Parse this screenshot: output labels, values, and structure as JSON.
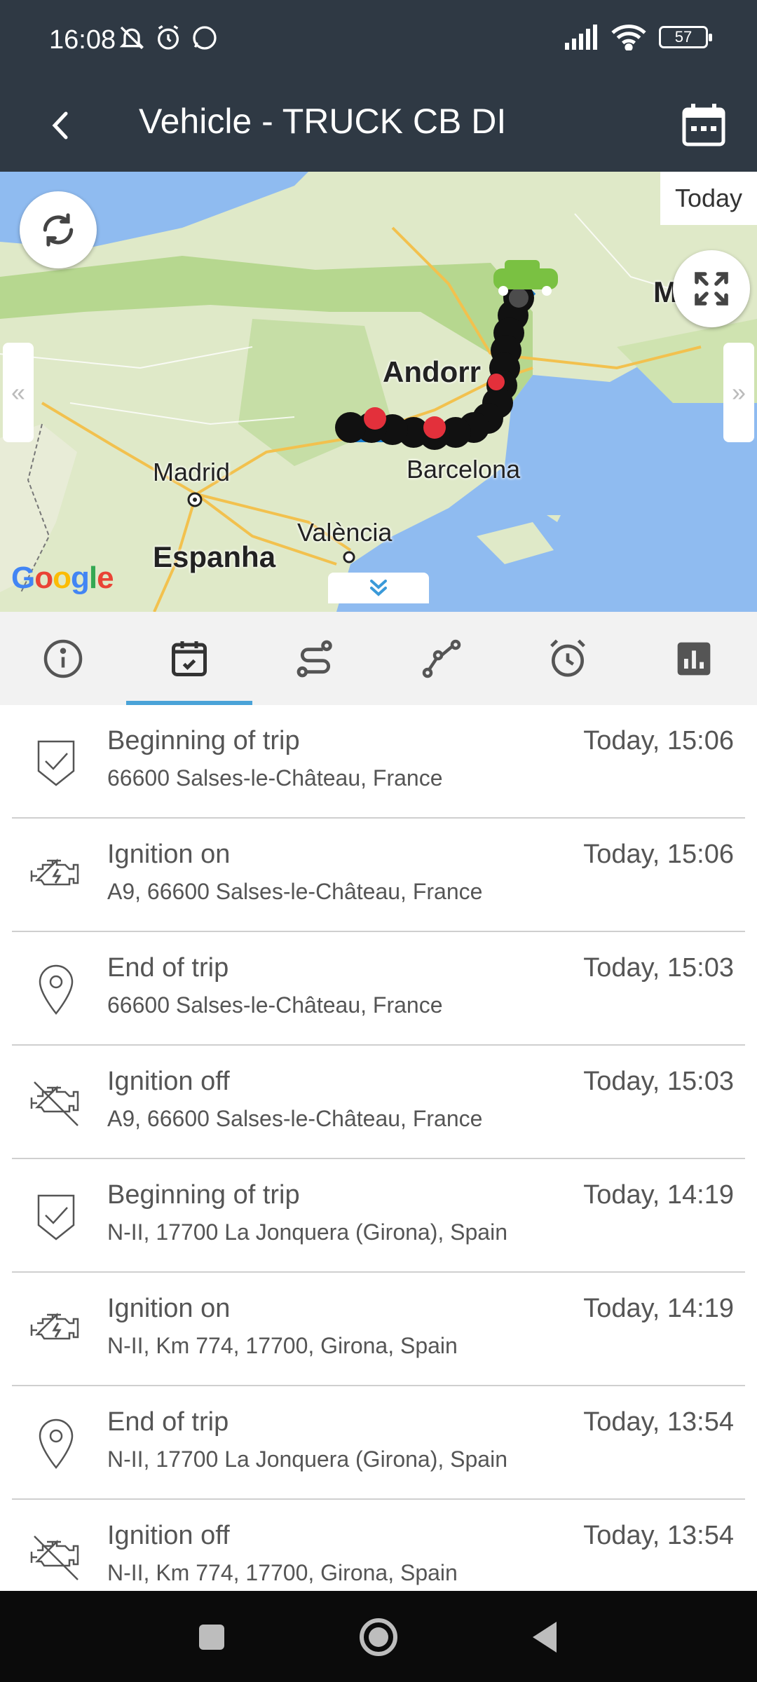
{
  "status_bar": {
    "time": "16:08",
    "battery": "57"
  },
  "header": {
    "title": "Vehicle - TRUCK CB DI"
  },
  "map": {
    "today_label": "Today",
    "labels": {
      "andorra": "Andorr",
      "madrid": "Madrid",
      "barcelona": "Barcelona",
      "valencia": "València",
      "espanha": "Espanha",
      "marseille": "M"
    },
    "google": "Google"
  },
  "tabs": [
    {
      "icon": "info-icon"
    },
    {
      "icon": "calendar-check-icon",
      "active": true
    },
    {
      "icon": "route-icon"
    },
    {
      "icon": "path-icon"
    },
    {
      "icon": "alarm-icon"
    },
    {
      "icon": "bar-chart-icon"
    }
  ],
  "events": [
    {
      "type": "Beginning of trip",
      "address": "66600 Salses-le-Château, France",
      "time": "Today, 15:06",
      "icon": "shield-check-icon"
    },
    {
      "type": "Ignition on",
      "address": "A9, 66600 Salses-le-Château, France",
      "time": "Today, 15:06",
      "icon": "engine-icon"
    },
    {
      "type": "End of trip",
      "address": "66600 Salses-le-Château, France",
      "time": "Today, 15:03",
      "icon": "location-pin-icon"
    },
    {
      "type": "Ignition off",
      "address": "A9, 66600 Salses-le-Château, France",
      "time": "Today, 15:03",
      "icon": "engine-off-icon"
    },
    {
      "type": "Beginning of trip",
      "address": "N-II, 17700 La Jonquera (Girona), Spain",
      "time": "Today, 14:19",
      "icon": "shield-check-icon"
    },
    {
      "type": "Ignition on",
      "address": "N-II, Km 774, 17700, Girona, Spain",
      "time": "Today, 14:19",
      "icon": "engine-icon"
    },
    {
      "type": "End of trip",
      "address": "N-II, 17700 La Jonquera (Girona), Spain",
      "time": "Today, 13:54",
      "icon": "location-pin-icon"
    },
    {
      "type": "Ignition off",
      "address": "N-II, Km 774, 17700, Girona, Spain",
      "time": "Today, 13:54",
      "icon": "engine-off-icon"
    }
  ]
}
